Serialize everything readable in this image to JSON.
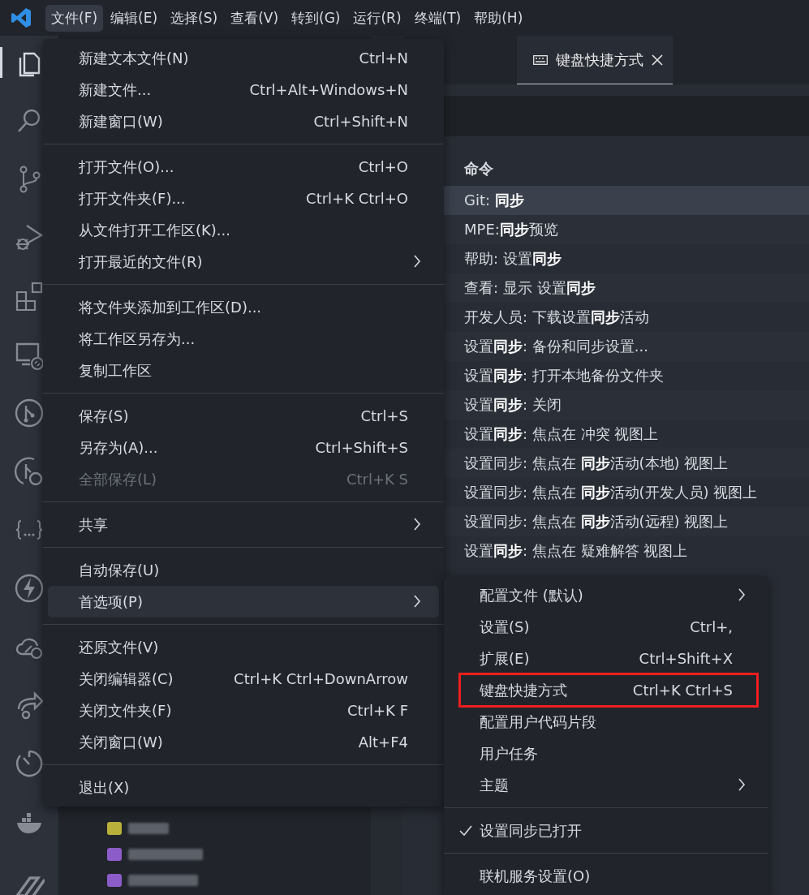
{
  "menu_bar": [
    {
      "label": "文件(F)",
      "selected": true
    },
    {
      "label": "编辑(E)",
      "selected": false
    },
    {
      "label": "选择(S)",
      "selected": false
    },
    {
      "label": "查看(V)",
      "selected": false
    },
    {
      "label": "转到(G)",
      "selected": false
    },
    {
      "label": "运行(R)",
      "selected": false
    },
    {
      "label": "终端(T)",
      "selected": false
    },
    {
      "label": "帮助(H)",
      "selected": false
    }
  ],
  "activity_bar": [
    {
      "kind": "files",
      "selected": true
    },
    {
      "kind": "search",
      "selected": false
    },
    {
      "kind": "branch",
      "selected": false
    },
    {
      "kind": "debug",
      "selected": false
    },
    {
      "kind": "extensions",
      "selected": false
    },
    {
      "kind": "remote",
      "selected": false
    },
    {
      "kind": "git-circle",
      "selected": false
    },
    {
      "kind": "git-search",
      "selected": false
    },
    {
      "kind": "braces",
      "selected": false
    },
    {
      "kind": "bolt",
      "selected": false
    },
    {
      "kind": "cloud",
      "selected": false
    },
    {
      "kind": "share",
      "selected": false
    },
    {
      "kind": "timer",
      "selected": false
    },
    {
      "kind": "whale",
      "selected": false
    },
    {
      "kind": "pen",
      "selected": false
    }
  ],
  "explorer": {
    "rows": [
      {
        "color": "#b8b03a"
      },
      {
        "color": "#8c5cc8"
      },
      {
        "color": "#8c5cc8"
      }
    ]
  },
  "editor": {
    "tab": {
      "title": "键盘快捷方式",
      "selected": true
    },
    "table": {
      "header": "命令",
      "rows": [
        {
          "command": "Git: **同步**",
          "selected": true
        },
        {
          "command": "MPE:**同步**预览",
          "selected": false
        },
        {
          "command": "帮助: 设置**同步**",
          "selected": false
        },
        {
          "command": "查看: 显示 设置**同步**",
          "selected": false
        },
        {
          "command": "开发人员: 下载设置**同步**活动",
          "selected": false
        },
        {
          "command": "设置**同步**: 备份和同步设置...",
          "selected": false
        },
        {
          "command": "设置**同步**: 打开本地备份文件夹",
          "selected": false
        },
        {
          "command": "设置**同步**: 关闭",
          "selected": false
        },
        {
          "command": "设置**同步**: 焦点在 冲突 视图上",
          "selected": false
        },
        {
          "command": "设置同步: 焦点在 **同步**活动(本地) 视图上",
          "selected": false
        },
        {
          "command": "设置同步: 焦点在 **同步**活动(开发人员) 视图上",
          "selected": false
        },
        {
          "command": "设置同步: 焦点在 **同步**活动(远程) 视图上",
          "selected": false
        },
        {
          "command": "设置**同步**: 焦点在 疑难解答 视图上",
          "selected": false
        }
      ]
    }
  },
  "file_menu": [
    {
      "kind": "item",
      "label": "新建文本文件(N)",
      "shortcut": "Ctrl+N",
      "disabled": false,
      "selected": false,
      "submenu": false
    },
    {
      "kind": "item",
      "label": "新建文件...",
      "shortcut": "Ctrl+Alt+Windows+N",
      "disabled": false,
      "selected": false,
      "submenu": false
    },
    {
      "kind": "item",
      "label": "新建窗口(W)",
      "shortcut": "Ctrl+Shift+N",
      "disabled": false,
      "selected": false,
      "submenu": false
    },
    {
      "kind": "separator"
    },
    {
      "kind": "item",
      "label": "打开文件(O)...",
      "shortcut": "Ctrl+O",
      "disabled": false,
      "selected": false,
      "submenu": false
    },
    {
      "kind": "item",
      "label": "打开文件夹(F)...",
      "shortcut": "Ctrl+K Ctrl+O",
      "disabled": false,
      "selected": false,
      "submenu": false
    },
    {
      "kind": "item",
      "label": "从文件打开工作区(K)...",
      "disabled": false,
      "selected": false,
      "submenu": false
    },
    {
      "kind": "item",
      "label": "打开最近的文件(R)",
      "disabled": false,
      "selected": false,
      "submenu": true
    },
    {
      "kind": "separator"
    },
    {
      "kind": "item",
      "label": "将文件夹添加到工作区(D)...",
      "disabled": false,
      "selected": false,
      "submenu": false
    },
    {
      "kind": "item",
      "label": "将工作区另存为...",
      "disabled": false,
      "selected": false,
      "submenu": false
    },
    {
      "kind": "item",
      "label": "复制工作区",
      "disabled": false,
      "selected": false,
      "submenu": false
    },
    {
      "kind": "separator"
    },
    {
      "kind": "item",
      "label": "保存(S)",
      "shortcut": "Ctrl+S",
      "disabled": false,
      "selected": false,
      "submenu": false
    },
    {
      "kind": "item",
      "label": "另存为(A)...",
      "shortcut": "Ctrl+Shift+S",
      "disabled": false,
      "selected": false,
      "submenu": false
    },
    {
      "kind": "item",
      "label": "全部保存(L)",
      "shortcut": "Ctrl+K S",
      "disabled": true,
      "selected": false,
      "submenu": false
    },
    {
      "kind": "separator"
    },
    {
      "kind": "item",
      "label": "共享",
      "disabled": false,
      "selected": false,
      "submenu": true
    },
    {
      "kind": "separator"
    },
    {
      "kind": "item",
      "label": "自动保存(U)",
      "disabled": false,
      "selected": false,
      "submenu": false
    },
    {
      "kind": "item",
      "label": "首选项(P)",
      "disabled": false,
      "selected": true,
      "submenu": true
    },
    {
      "kind": "separator"
    },
    {
      "kind": "item",
      "label": "还原文件(V)",
      "disabled": false,
      "selected": false,
      "submenu": false
    },
    {
      "kind": "item",
      "label": "关闭编辑器(C)",
      "shortcut": "Ctrl+K Ctrl+DownArrow",
      "disabled": false,
      "selected": false,
      "submenu": false
    },
    {
      "kind": "item",
      "label": "关闭文件夹(F)",
      "shortcut": "Ctrl+K F",
      "disabled": false,
      "selected": false,
      "submenu": false
    },
    {
      "kind": "item",
      "label": "关闭窗口(W)",
      "shortcut": "Alt+F4",
      "disabled": false,
      "selected": false,
      "submenu": false
    },
    {
      "kind": "separator"
    },
    {
      "kind": "item",
      "label": "退出(X)",
      "disabled": false,
      "selected": false,
      "submenu": false
    }
  ],
  "preferences_menu": [
    {
      "kind": "item",
      "label": "配置文件 (默认)",
      "submenu": true,
      "checked": false,
      "highlighted": false
    },
    {
      "kind": "item",
      "label": "设置(S)",
      "shortcut": "Ctrl+,",
      "submenu": false,
      "checked": false,
      "highlighted": false
    },
    {
      "kind": "item",
      "label": "扩展(E)",
      "shortcut": "Ctrl+Shift+X",
      "submenu": false,
      "checked": false,
      "highlighted": false
    },
    {
      "kind": "item",
      "label": "键盘快捷方式",
      "shortcut": "Ctrl+K Ctrl+S",
      "submenu": false,
      "checked": false,
      "highlighted": true
    },
    {
      "kind": "item",
      "label": "配置用户代码片段",
      "submenu": false,
      "checked": false,
      "highlighted": false
    },
    {
      "kind": "item",
      "label": "用户任务",
      "submenu": false,
      "checked": false,
      "highlighted": false
    },
    {
      "kind": "item",
      "label": "主题",
      "submenu": true,
      "checked": false,
      "highlighted": false
    },
    {
      "kind": "separator"
    },
    {
      "kind": "item",
      "label": "设置同步已打开",
      "submenu": false,
      "checked": true,
      "highlighted": false
    },
    {
      "kind": "separator"
    },
    {
      "kind": "item",
      "label": "联机服务设置(O)",
      "submenu": false,
      "checked": false,
      "highlighted": false
    }
  ]
}
